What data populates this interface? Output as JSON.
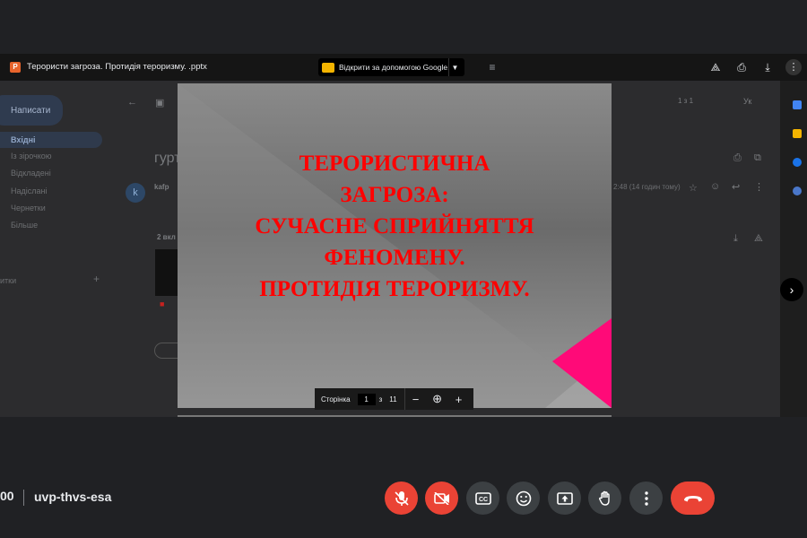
{
  "viewer": {
    "file_name": "Терористи загроза. Протидія тероризму. .pptx",
    "file_icon_letter": "P",
    "open_with_label": "Відкрити за допомогою Google...",
    "icons": [
      "add-to-drive-icon",
      "print-icon",
      "download-icon",
      "more-vert-icon"
    ]
  },
  "gmail_background": {
    "compose_label": "Написати",
    "folders": [
      "Вхідні",
      "Із зірочкою",
      "Відкладені",
      "Надіслані",
      "Чернетки",
      "Більше"
    ],
    "labels_heading": "итки",
    "subject_fragment": "гурт",
    "sender_initial": "k",
    "sender_fragment": "kafp",
    "attachment_count_fragment": "2 вкл",
    "date_fragment": "2:48 (14 годин тому)",
    "page_range_fragment": "1 з 1",
    "language_fragment": "Ук"
  },
  "slide": {
    "title": "ТЕРОРИСТИЧНА\nЗАГРОЗА:\nСУЧАСНЕ СПРИЙНЯТТЯ\nФЕНОМЕНУ.\nПРОТИДІЯ ТЕРОРИЗМУ.",
    "title_color": "#ff0000",
    "accent_color": "#ff0a78"
  },
  "page_nav": {
    "label": "Сторінка",
    "current_page": "1",
    "of": "з",
    "total_pages": "11"
  },
  "meeting": {
    "time_fragment": "00",
    "code": "uvp-thvs-esa",
    "controls": [
      "mic-off-icon",
      "camera-off-icon",
      "captions-icon",
      "emoji-icon",
      "present-screen-icon",
      "raise-hand-icon",
      "more-options-icon",
      "hang-up-icon"
    ],
    "colors": {
      "danger": "#ea4335",
      "control_bg": "#3c4043",
      "background": "#202124"
    }
  }
}
